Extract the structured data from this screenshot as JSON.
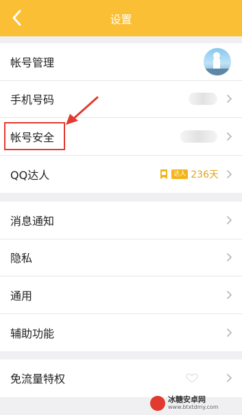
{
  "header": {
    "title": "设置"
  },
  "groups": [
    {
      "items": [
        {
          "label": "帐号管理"
        },
        {
          "label": "手机号码"
        },
        {
          "label": "帐号安全"
        },
        {
          "label": "QQ达人",
          "badge_text": "达人",
          "days": "236天"
        }
      ]
    },
    {
      "items": [
        {
          "label": "消息通知"
        },
        {
          "label": "隐私"
        },
        {
          "label": "通用"
        },
        {
          "label": "辅助功能"
        }
      ]
    },
    {
      "items": [
        {
          "label": "免流量特权"
        }
      ]
    }
  ],
  "watermark": {
    "name": "冰糖安卓网",
    "url": "www.btxtdmy.com"
  },
  "colors": {
    "header": "#fbbf36",
    "highlight": "#e23a2f",
    "accent": "#e2a31c"
  },
  "icons": {
    "back": "chevron-left-icon",
    "chevron": "chevron-right-icon",
    "badge": "qq-talent-badge-icon",
    "heart": "heart-outline-icon"
  }
}
